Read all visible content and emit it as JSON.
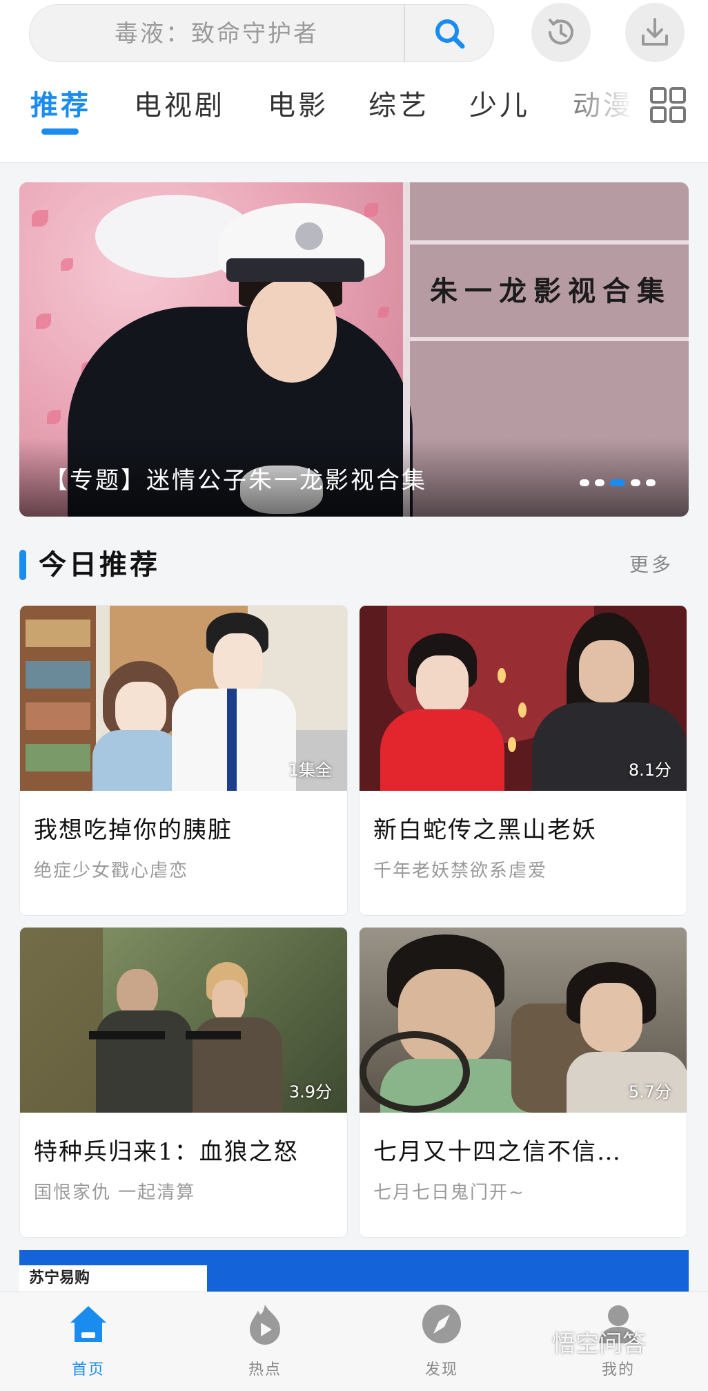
{
  "search": {
    "placeholder": "毒液：致命守护者"
  },
  "tabs": [
    {
      "label": "推荐",
      "active": true
    },
    {
      "label": "电视剧",
      "active": false
    },
    {
      "label": "电影",
      "active": false
    },
    {
      "label": "综艺",
      "active": false
    },
    {
      "label": "少儿",
      "active": false
    },
    {
      "label": "动漫",
      "active": false
    }
  ],
  "banner": {
    "caption": "【专题】迷情公子朱一龙影视合集",
    "artwork_text": "朱一龙影视合集",
    "slide_count": 5,
    "active_slide": 3
  },
  "section": {
    "title": "今日推荐",
    "more": "更多"
  },
  "cards": [
    {
      "title": "我想吃掉你的胰脏",
      "subtitle": "绝症少女戳心虐恋",
      "badge": "1集全"
    },
    {
      "title": "新白蛇传之黑山老妖",
      "subtitle": "千年老妖禁欲系虐爱",
      "badge": "8.1分"
    },
    {
      "title": "特种兵归来1：血狼之怒",
      "subtitle": "国恨家仇 一起清算",
      "badge": "3.9分"
    },
    {
      "title": "七月又十四之信不信…",
      "subtitle": "七月七日鬼门开~",
      "badge": "5.7分"
    }
  ],
  "ad": {
    "logo_text": "苏宁易购"
  },
  "bottom_nav": [
    {
      "label": "首页",
      "icon": "home-icon",
      "active": true
    },
    {
      "label": "热点",
      "icon": "flame-play-icon",
      "active": false
    },
    {
      "label": "发现",
      "icon": "compass-icon",
      "active": false
    },
    {
      "label": "我的",
      "icon": "user-icon",
      "active": false
    }
  ],
  "watermark": "悟空问答",
  "colors": {
    "accent": "#1a8cf0",
    "text_primary": "#111111",
    "text_secondary": "#999999",
    "background": "#f4f5f7"
  }
}
